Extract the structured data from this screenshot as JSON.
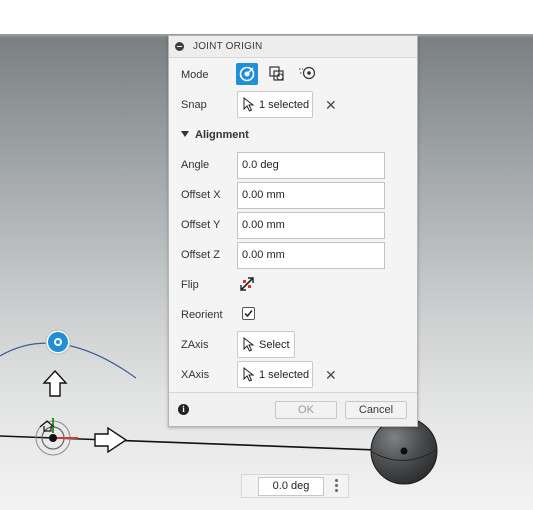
{
  "dialog": {
    "title": "JOINT ORIGIN",
    "mode_label": "Mode",
    "mode_options": [
      "simple-origin-icon",
      "between-two-faces-icon",
      "offset-origin-icon"
    ],
    "snap_label": "Snap",
    "snap_value": "1 selected",
    "alignment_section": "Alignment",
    "angle_label": "Angle",
    "angle_value": "0.0 deg",
    "offset_x_label": "Offset X",
    "offset_x_value": "0.00 mm",
    "offset_y_label": "Offset Y",
    "offset_y_value": "0.00 mm",
    "offset_z_label": "Offset Z",
    "offset_z_value": "0.00 mm",
    "flip_label": "Flip",
    "reorient_label": "Reorient",
    "reorient_checked": true,
    "zaxis_label": "ZAxis",
    "zaxis_value": "Select",
    "xaxis_label": "XAxis",
    "xaxis_value": "1 selected",
    "ok_label": "OK",
    "cancel_label": "Cancel"
  },
  "viewport": {
    "angle_readout": "0.0 deg"
  },
  "colors": {
    "accent": "#1f8fd6",
    "dialog_bg": "#f4f4f4"
  }
}
